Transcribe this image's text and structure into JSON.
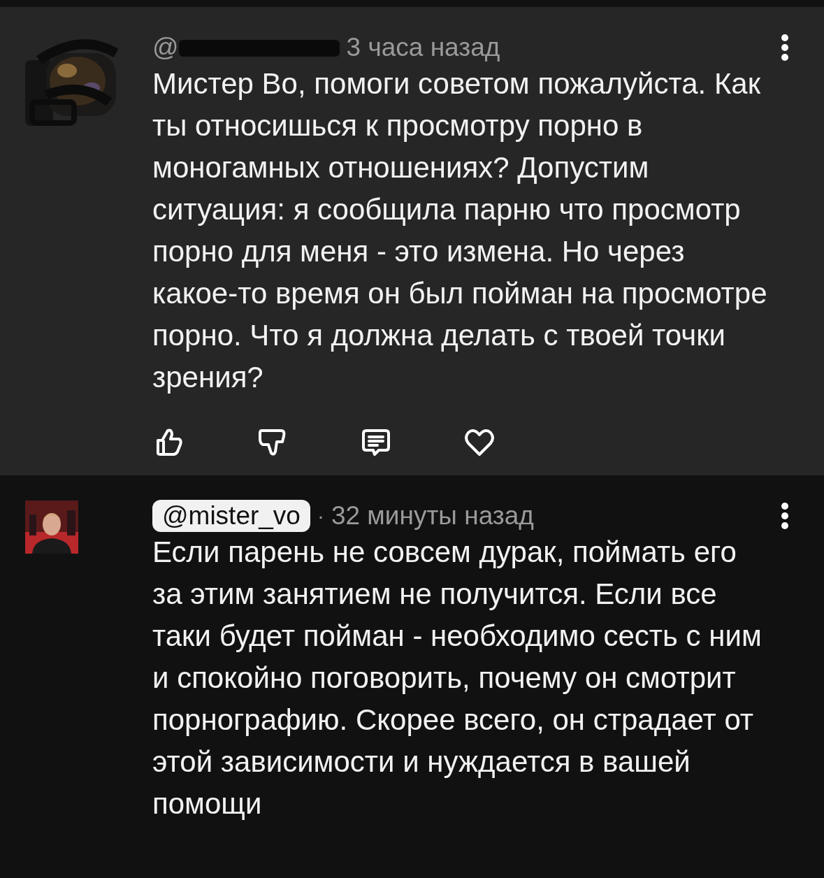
{
  "comments": [
    {
      "author": "@",
      "author_redacted": true,
      "author_highlighted": false,
      "time": "3 часа назад",
      "text": "Мистер Во, помоги советом пожалуйста. Как ты относишься к просмотру порно в моногамных отношениях? Допустим ситуация: я сообщила парню что просмотр порно для меня - это измена. Но через какое-то время он был пойман на просмотре порно. Что я должна делать с твоей точки зрения?",
      "actions": [
        {
          "kind": "like"
        },
        {
          "kind": "dislike"
        },
        {
          "kind": "reply"
        },
        {
          "kind": "heart"
        }
      ],
      "raised": true
    },
    {
      "author": "@mister_vo",
      "author_redacted": false,
      "author_highlighted": true,
      "separator": "·",
      "time": "32 минуты назад",
      "text": "Если парень не совсем дурак, поймать его за этим занятием не получится. Если все таки будет пойман - необходимо сесть с ним и спокойно поговорить, почему он смотрит порнографию. Скорее всего, он страдает от этой зависимости и нуждается в вашей помощи",
      "raised": false
    }
  ]
}
